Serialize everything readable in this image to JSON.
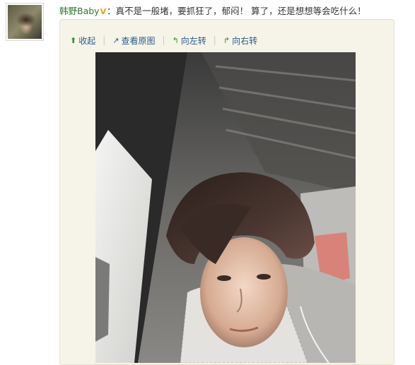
{
  "post": {
    "username": "韩野Baby",
    "verified_badge": "V",
    "separator": "：",
    "message": "真不是一般堵，要抓狂了，郁闷！  算了，还是想想等会吃什么！"
  },
  "toolbar": {
    "collapse_label": "收起",
    "view_original_label": "查看原图",
    "rotate_left_label": "向左转",
    "rotate_right_label": "向右转",
    "divider": "|"
  },
  "icons": {
    "collapse": "up-arrow-icon",
    "view_original": "external-link-icon",
    "rotate_left": "rotate-left-icon",
    "rotate_right": "rotate-right-icon",
    "verified": "vip-badge-icon"
  },
  "colors": {
    "username": "#2c7a2c",
    "link": "#2c5a8a",
    "verified_badge": "#e8a000",
    "media_background": "#f6f4e8"
  }
}
